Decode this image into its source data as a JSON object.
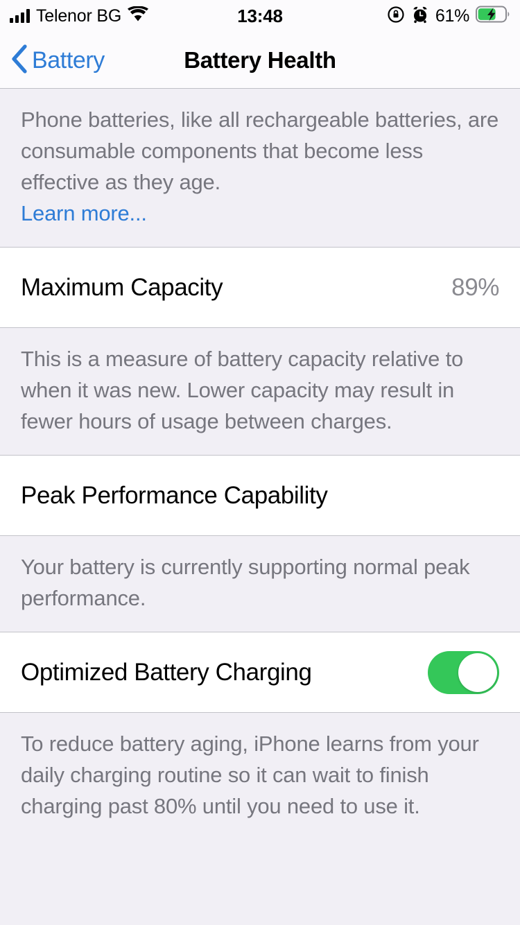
{
  "status_bar": {
    "carrier": "Telenor BG",
    "time": "13:48",
    "battery_percent": "61%",
    "signal_bars": 4,
    "icons": [
      "signal-bars-icon",
      "wifi-icon",
      "rotation-lock-icon",
      "alarm-clock-icon",
      "battery-charging-icon"
    ]
  },
  "nav": {
    "back_label": "Battery",
    "title": "Battery Health"
  },
  "intro": {
    "text": "Phone batteries, like all rechargeable batteries, are consumable components that become less effective as they age.",
    "link_label": "Learn more..."
  },
  "maximum_capacity": {
    "label": "Maximum Capacity",
    "value": "89%",
    "description": "This is a measure of battery capacity relative to when it was new. Lower capacity may result in fewer hours of usage between charges."
  },
  "peak_performance": {
    "label": "Peak Performance Capability",
    "description": "Your battery is currently supporting normal peak performance."
  },
  "optimized_charging": {
    "label": "Optimized Battery Charging",
    "enabled": true,
    "description": "To reduce battery aging, iPhone learns from your daily charging routine so it can wait to finish charging past 80% until you need to use it."
  },
  "colors": {
    "accent_blue": "#2E7CD6",
    "toggle_green": "#34C759",
    "group_background": "#F1EFF5",
    "secondary_text": "#76767E"
  }
}
